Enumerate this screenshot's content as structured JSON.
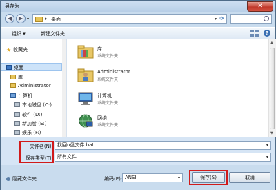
{
  "window": {
    "title": "另存为",
    "close_glyph": "✕"
  },
  "address": {
    "folder_icon": "folder-icon",
    "separator": "▸",
    "path": "桌面",
    "dropdown_glyph": "▾",
    "refresh_glyph": "⟳"
  },
  "search": {
    "placeholder": ""
  },
  "toolbar": {
    "organize": "组织 ▾",
    "new_folder": "新建文件夹",
    "help_glyph": "?"
  },
  "nav": {
    "favorites": "收藏夹",
    "desktop": "桌面",
    "library": "库",
    "user": "Administrator",
    "computer": "计算机",
    "drives": [
      "本地磁盘 (C:)",
      "软件 (D:)",
      "新加卷 (E:)",
      "娱乐 (F:)"
    ]
  },
  "files": [
    {
      "name": "库",
      "type": "系统文件夹",
      "icon": "library-folder-icon"
    },
    {
      "name": "Administrator",
      "type": "系统文件夹",
      "icon": "user-folder-icon"
    },
    {
      "name": "计算机",
      "type": "系统文件夹",
      "icon": "computer-icon"
    },
    {
      "name": "网络",
      "type": "系统文件夹",
      "icon": "network-icon"
    }
  ],
  "form": {
    "filename_label": "文件名(N):",
    "filename_value": "找回u盘文件.bat",
    "filetype_label": "保存类型(T):",
    "filetype_value": "所有文件"
  },
  "bottom": {
    "hide_folders": "隐藏文件夹",
    "encoding_label": "编码(E):",
    "encoding_value": "ANSI",
    "save": "保存(S)",
    "cancel": "取消"
  },
  "colors": {
    "highlight": "#d11a1a",
    "frame": "#c9dcee"
  }
}
